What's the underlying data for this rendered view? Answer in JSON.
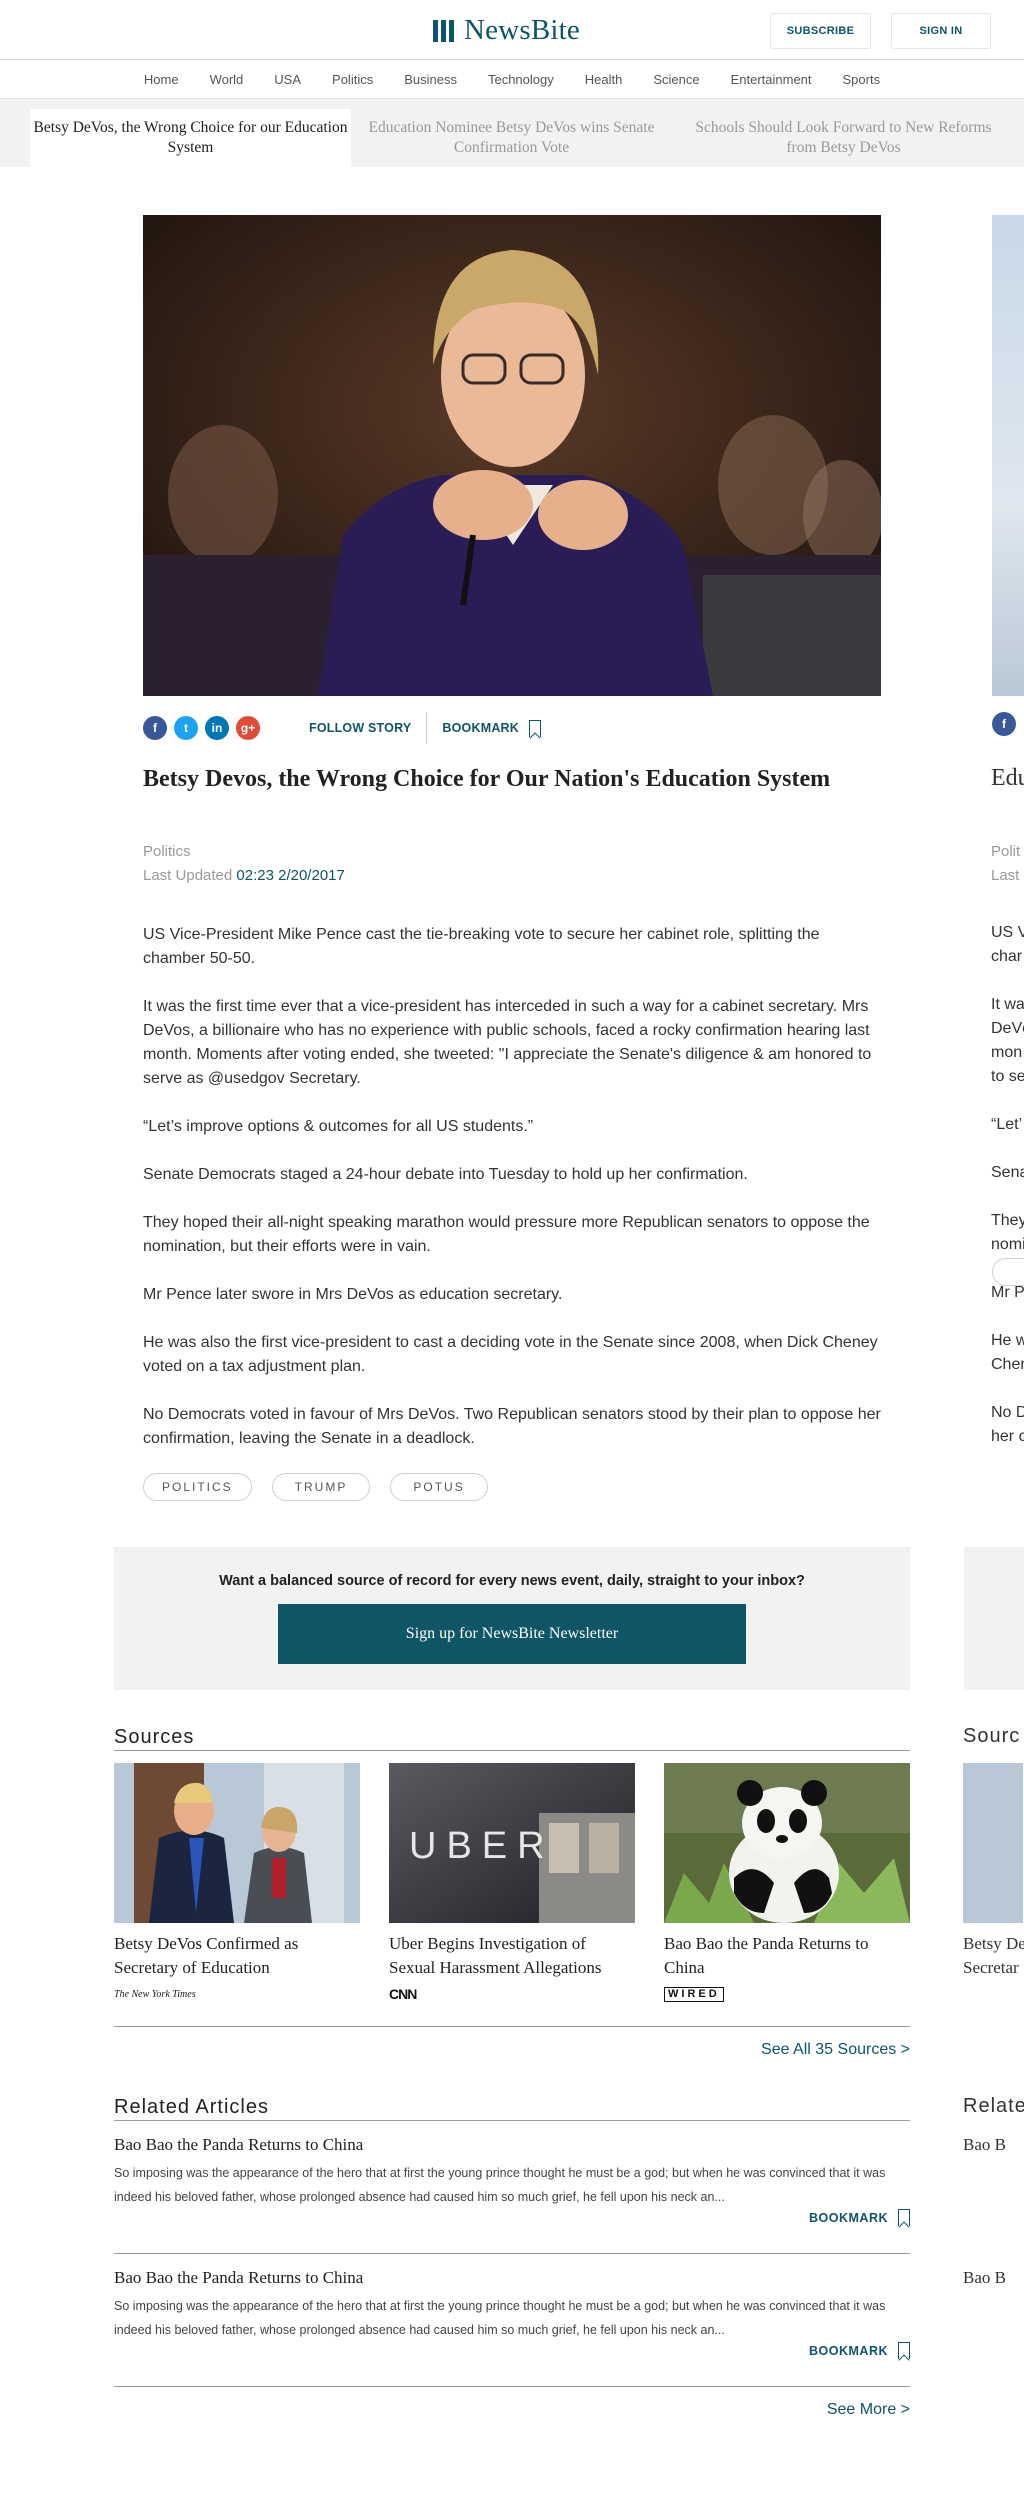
{
  "header": {
    "brand": "NewsBite",
    "subscribe": "SUBSCRIBE",
    "sign_in": "SIGN IN",
    "brand_color": "#0e5565"
  },
  "nav": [
    "Home",
    "World",
    "USA",
    "Politics",
    "Business",
    "Technology",
    "Health",
    "Science",
    "Entertainment",
    "Sports"
  ],
  "story_tabs": [
    {
      "label": "Betsy DeVos, the Wrong Choice for our Education System",
      "active": true
    },
    {
      "label": "Education Nominee Betsy DeVos wins Senate Confirmation Vote",
      "active": false
    },
    {
      "label": "Schools Should Look Forward to New Reforms from Betsy DeVos",
      "active": false
    }
  ],
  "article": {
    "share_icons": [
      "facebook-icon",
      "twitter-icon",
      "linkedin-icon",
      "googleplus-icon"
    ],
    "follow": "FOLLOW STORY",
    "bookmark": "BOOKMARK",
    "title": "Betsy Devos, the Wrong Choice for Our Nation's Education System",
    "category": "Politics",
    "updated_label": "Last Updated",
    "updated_value": "02:23 2/20/2017",
    "paragraphs": [
      "US Vice-President Mike Pence cast the tie-breaking vote to secure her cabinet role, splitting the chamber 50-50.",
      "It was the first time ever that a vice-president has interceded in such a way for a cabinet secretary. Mrs DeVos, a billionaire who has no experience with public schools, faced a rocky confirmation hearing last month. Moments after voting ended, she tweeted: \"I appreciate the Senate's diligence & am honored to serve as @usedgov Secretary.",
      "“Let’s improve options & outcomes for all US students.”",
      "Senate Democrats staged a 24-hour debate into Tuesday to hold up her confirmation.",
      "They hoped their all-night speaking marathon would pressure more Republican senators to oppose the nomination, but their efforts were in vain.",
      "Mr Pence later swore in Mrs DeVos as education secretary.",
      "He was also the first vice-president to cast a deciding vote in the Senate since 2008, when Dick Cheney voted on a tax adjustment plan.",
      "No Democrats voted in favour of Mrs DeVos. Two Republican senators stood by their plan to oppose her confirmation, leaving the Senate in a deadlock."
    ],
    "tags": [
      "POLITICS",
      "TRUMP",
      "POTUS"
    ]
  },
  "newsletter": {
    "question": "Want a balanced source of record for every news event, daily, straight to your inbox?",
    "button": "Sign up for NewsBite Newsletter"
  },
  "sources": {
    "heading": "Sources",
    "items": [
      {
        "title": "Betsy DeVos Confirmed as Secretary of Education",
        "outlet": "The New York Times"
      },
      {
        "title": "Uber Begins Investigation of Sexual Harassment Allegations",
        "outlet": "CNN"
      },
      {
        "title": "Bao Bao the Panda Returns to China",
        "outlet": "WIRED"
      }
    ],
    "see_all": "See All 35 Sources  >"
  },
  "related": {
    "heading": "Related Articles",
    "items": [
      {
        "title": "Bao Bao the Panda Returns to China",
        "excerpt": "So imposing was the appearance of the hero that at first the young prince thought he must be a god; but when he was convinced that it was indeed his beloved father, whose prolonged absence had caused him so much grief, he fell upon his neck an...",
        "bookmark": "BOOKMARK"
      },
      {
        "title": "Bao Bao the Panda Returns to China",
        "excerpt": "So imposing was the appearance of the hero that at first the young prince thought he must be a god; but when he was convinced that it was indeed his beloved father, whose prolonged absence had caused him so much grief, he fell upon his neck an...",
        "bookmark": "BOOKMARK"
      }
    ],
    "see_more": "See More >"
  },
  "peek": {
    "lines": [
      "Edu",
      "Polit",
      "Last",
      "US V",
      "char",
      "It wa",
      "DeVc",
      "mon",
      "to se",
      "“Let’",
      "Sena",
      "They",
      "nomi",
      "Mr P",
      "He w",
      "Chen",
      "No D",
      "her c"
    ],
    "sources": "Sourc",
    "related": "Relate",
    "rel_title": "Bao B",
    "src_title_1": "Betsy De",
    "src_title_2": "Secretar"
  }
}
